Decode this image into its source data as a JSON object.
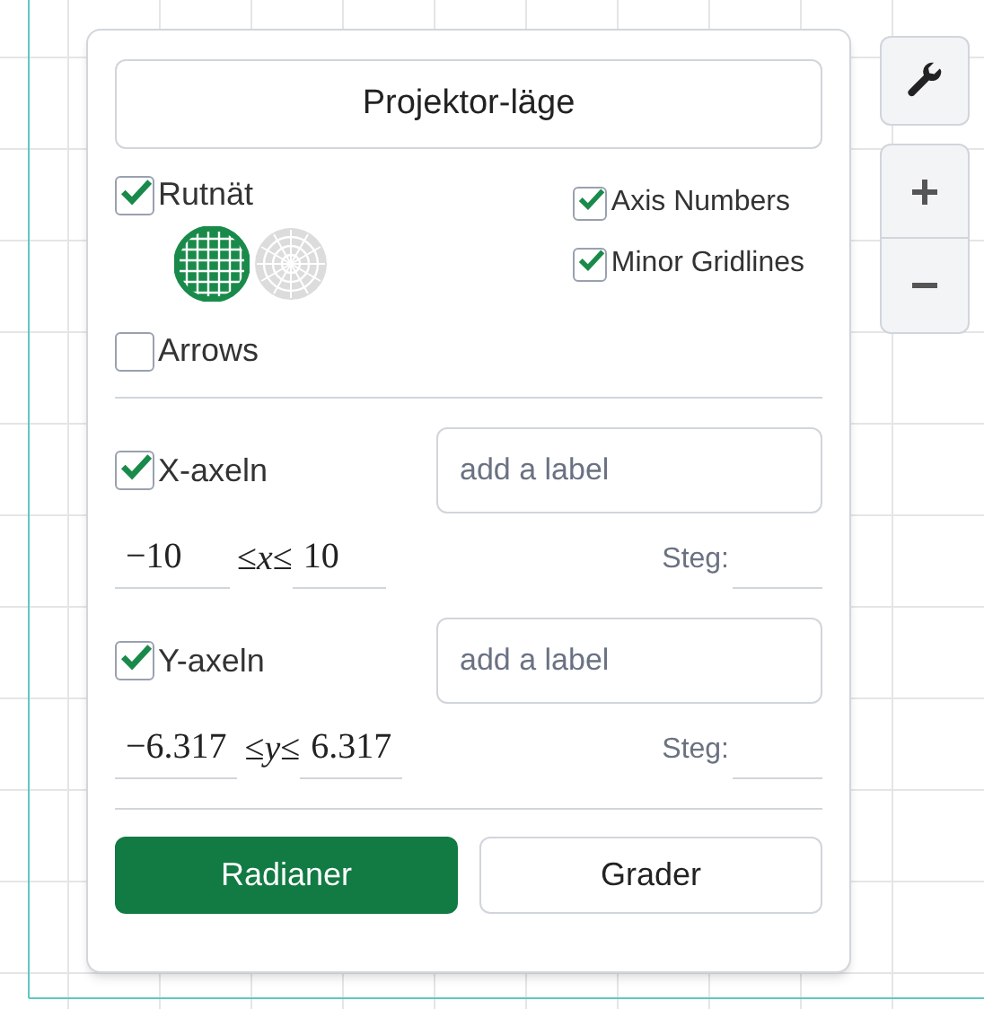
{
  "title_button": {
    "label": "Projektor-läge"
  },
  "grid": {
    "label": "Rutnät",
    "checked": true,
    "modes": [
      {
        "kind": "cartesian",
        "selected": true
      },
      {
        "kind": "polar",
        "selected": false
      }
    ]
  },
  "options": [
    {
      "label": "Axis Numbers",
      "checked": true
    },
    {
      "label": "Minor Gridlines",
      "checked": true
    }
  ],
  "arrows": {
    "label": "Arrows",
    "checked": false
  },
  "axes": [
    {
      "label": "X-axeln",
      "checked": true,
      "placeholder": "add a label",
      "min": "−10",
      "lower_relation": "≤",
      "variable": "x",
      "upper_relation": "≤",
      "max": "10",
      "step_label": "Steg:"
    },
    {
      "label": "Y-axeln",
      "checked": true,
      "placeholder": "add a label",
      "min": "−6.317",
      "lower_relation": "≤",
      "variable": "y",
      "upper_relation": "≤",
      "max": "6.317",
      "step_label": "Steg:"
    }
  ],
  "angle_units": [
    {
      "label": "Radianer",
      "selected": true
    },
    {
      "label": "Grader",
      "selected": false
    }
  ]
}
